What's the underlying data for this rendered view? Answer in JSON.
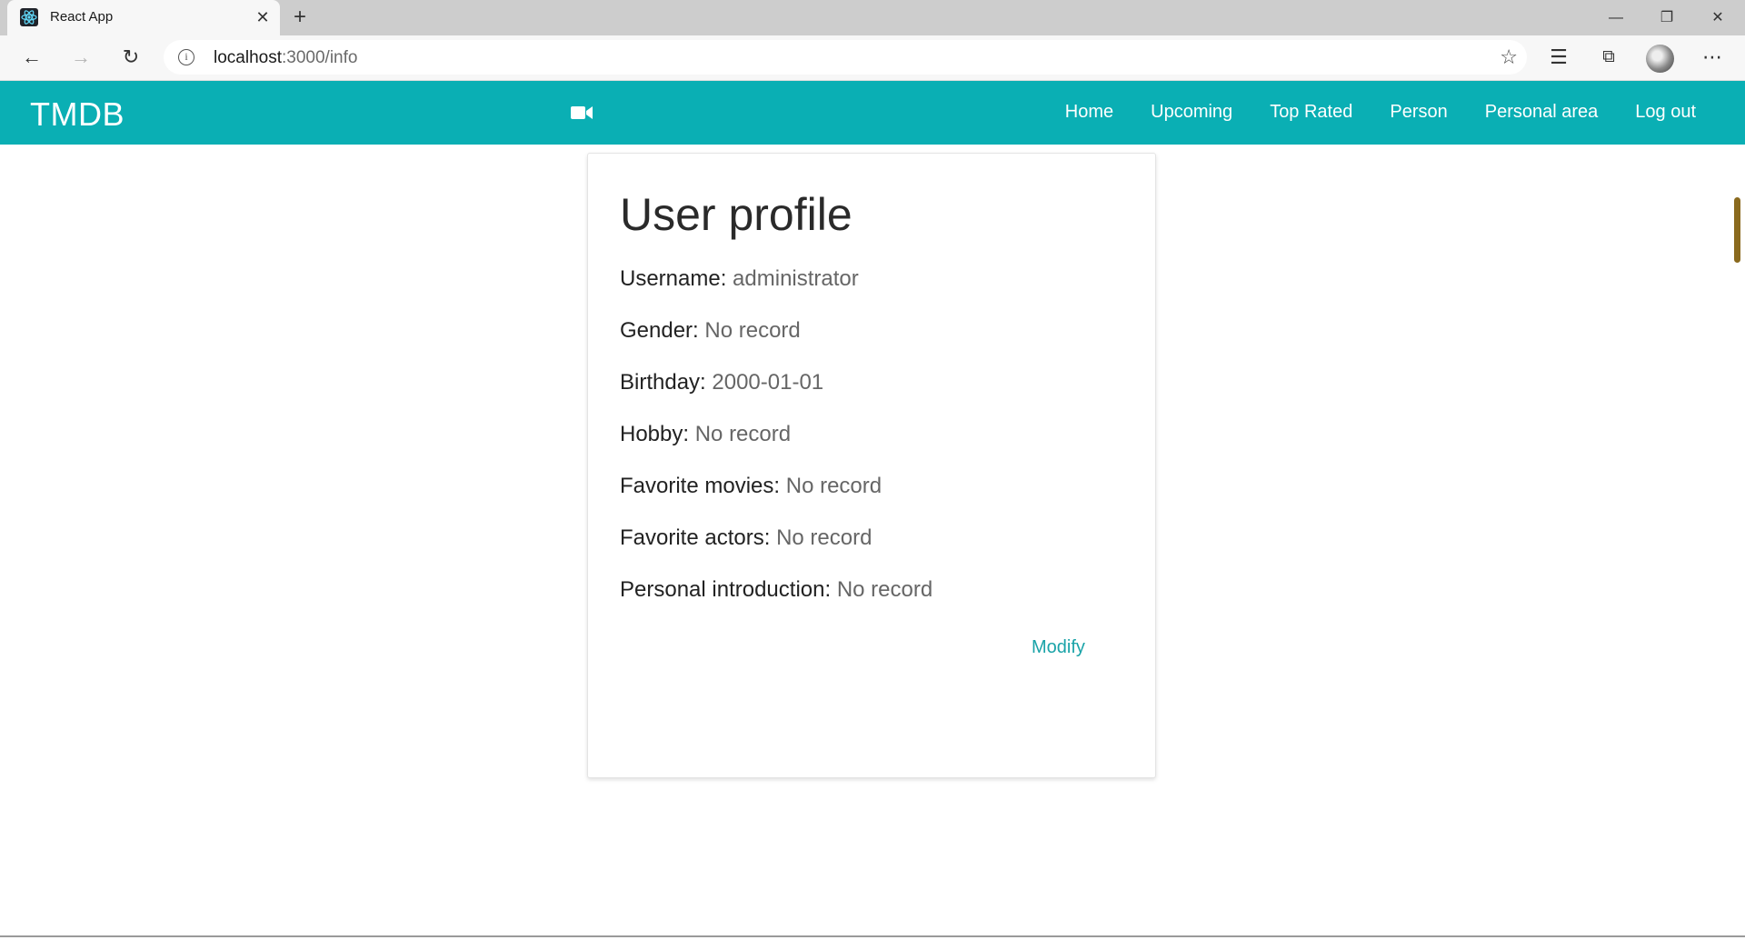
{
  "browser": {
    "tab_title": "React App",
    "tab_close_icon": "close-icon",
    "new_tab_icon": "plus-icon",
    "url_host": "localhost",
    "url_path": ":3000/info",
    "icons": [
      "back-icon",
      "forward-icon",
      "refresh-icon",
      "info-icon",
      "star-icon",
      "favorites-icon",
      "collections-icon",
      "profile-avatar",
      "more-icon"
    ]
  },
  "navbar": {
    "brand": "TMDB",
    "background_color": "#0aafb4",
    "camera_icon": "video-camera-icon",
    "links": [
      "Home",
      "Upcoming",
      "Top Rated",
      "Person",
      "Personal area",
      "Log out"
    ]
  },
  "profile": {
    "title": "User profile",
    "fields": [
      {
        "label": "Username:",
        "value": "administrator"
      },
      {
        "label": "Gender:",
        "value": "No record"
      },
      {
        "label": "Birthday:",
        "value": "2000-01-01"
      },
      {
        "label": "Hobby:",
        "value": "No record"
      },
      {
        "label": "Favorite movies:",
        "value": "No record"
      },
      {
        "label": "Favorite actors:",
        "value": "No record"
      },
      {
        "label": "Personal introduction:",
        "value": "No record"
      }
    ],
    "modify_label": "Modify",
    "link_color": "#1aa3a8"
  }
}
